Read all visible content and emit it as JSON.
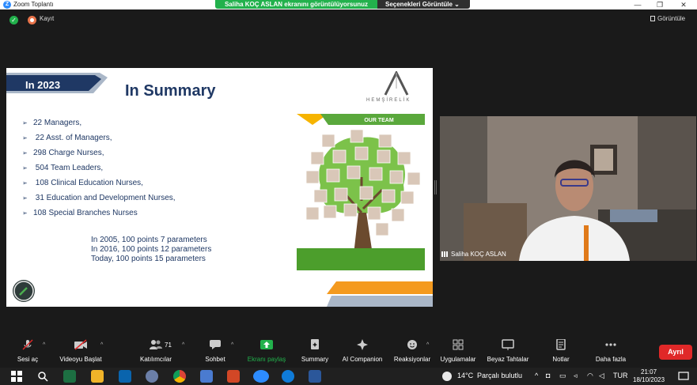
{
  "titlebar": {
    "app_title": "Zoom Toplantı",
    "sharing_banner": "Saliha KOÇ ASLAN ekranını görüntülüyorsunuz",
    "view_options": "Seçenekleri Görüntüle",
    "minimize": "—",
    "restore": "❐",
    "close": "✕"
  },
  "topbar": {
    "record_label": "Kayıt",
    "view_label": "Görüntüle"
  },
  "slide": {
    "year": "In 2023",
    "title": "In Summary",
    "logo_text": "HEMŞİRELİK",
    "items": [
      "22 Managers,",
      " 22 Asst. of Managers,",
      "298 Charge Nurses,",
      " 504 Team Leaders,",
      " 108 Clinical Education Nurses,",
      " 31 Education and Development Nurses,",
      "108 Special Branches Nurses"
    ],
    "points": [
      "In 2005, 100 points 7 parameters",
      "In 2016, 100 points 12 parameters",
      "Today, 100 points 15 parameters"
    ],
    "team_banner": "OUR TEAM"
  },
  "video": {
    "participant_name": "Saliha KOÇ ASLAN"
  },
  "toolbar": {
    "mute": "Sesi aç",
    "video": "Videoyu Başlat",
    "participants": "Katılımcılar",
    "participants_count": "71",
    "chat": "Sohbet",
    "share": "Ekranı paylaş",
    "summary": "Summary",
    "ai": "AI Companion",
    "reactions": "Reaksiyonlar",
    "apps": "Uygulamalar",
    "whiteboard": "Beyaz Tahtalar",
    "notes": "Notlar",
    "more": "Daha fazla",
    "leave": "Ayrıl"
  },
  "taskbar": {
    "temperature": "14°C",
    "weather": "Parçalı bulutlu",
    "language": "TUR",
    "time": "21:07",
    "date": "18/10/2023"
  },
  "colors": {
    "accent_green": "#22b14c",
    "leave_red": "#e02828",
    "slide_navy": "#1f3864"
  }
}
